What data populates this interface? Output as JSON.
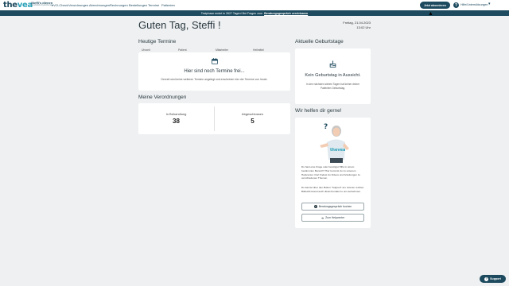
{
  "brand": {
    "logo_main": "the",
    "logo_accent": "vea",
    "user_name": "Steffi’s dienen",
    "user_sub": "Berufsbild physiotherapie"
  },
  "nav": {
    "items": [
      "eVO-Check",
      "Verordnungen",
      "Abrechnungen",
      "Rechnungen",
      "Bestellungen",
      "Termine",
      "Patienten"
    ]
  },
  "header": {
    "subscribe_label": "Jetzt abonnieren",
    "help_label": "Hilfe/Unterstützungen",
    "help_icon": "question-icon"
  },
  "banner": {
    "text": "Testphase endet in 2627 Tagen! Bei Fragen zum",
    "link": "Beratungsgespräch vereinbaren"
  },
  "greeting": "Guten Tag, Steffi !",
  "date": {
    "day": "Freitag, 21.04.2023",
    "time": "13:02 Uhr"
  },
  "appointments": {
    "title": "Heutige Termine",
    "columns": [
      "Uhrzeit",
      "Patient",
      "Mitarbeiter",
      "Heilmittel"
    ],
    "empty_title": "Hier sind noch Termine frei...",
    "empty_sub": "Derzeit sind keine weiteren Termine angelegt und erscheinen hier der Termine von heute."
  },
  "prescriptions": {
    "title": "Meine Verordnungen",
    "stats": [
      {
        "label": "In Behandlung",
        "value": "38"
      },
      {
        "label": "Abgeschlossen",
        "value": "5"
      }
    ]
  },
  "birthdays": {
    "title": "Aktuelle Geburtstage",
    "empty_title": "Kein Geburtstag in Aussicht.",
    "empty_sub": "In den nächsten sieben Tagen hat keiner deiner Patienten Geburtstag."
  },
  "help": {
    "title": "Wir helfen dir gerne!",
    "mascot_text": "thevea",
    "text1": "Du hast eine Frage oder benötigst Hilfe in einem bestimmten Bereich? Hier kommst du zu unserem Helpcenter. Dort findest du Videos und Anleitungen zu verschiedenen Themen.",
    "text2": "Du kannst über den Button \"Support\" am unteren rechten Bildschirmrand auch direkt Kontakt zu uns aufnehmen.",
    "btn_consult": "Beratungsgespräch buchen",
    "btn_helpcenter": "Zum Helpcenter"
  },
  "support": {
    "label": "Support"
  },
  "colors": {
    "primary": "#1d4a5e",
    "accent": "#2aa1b8",
    "background": "#eef0f1"
  }
}
